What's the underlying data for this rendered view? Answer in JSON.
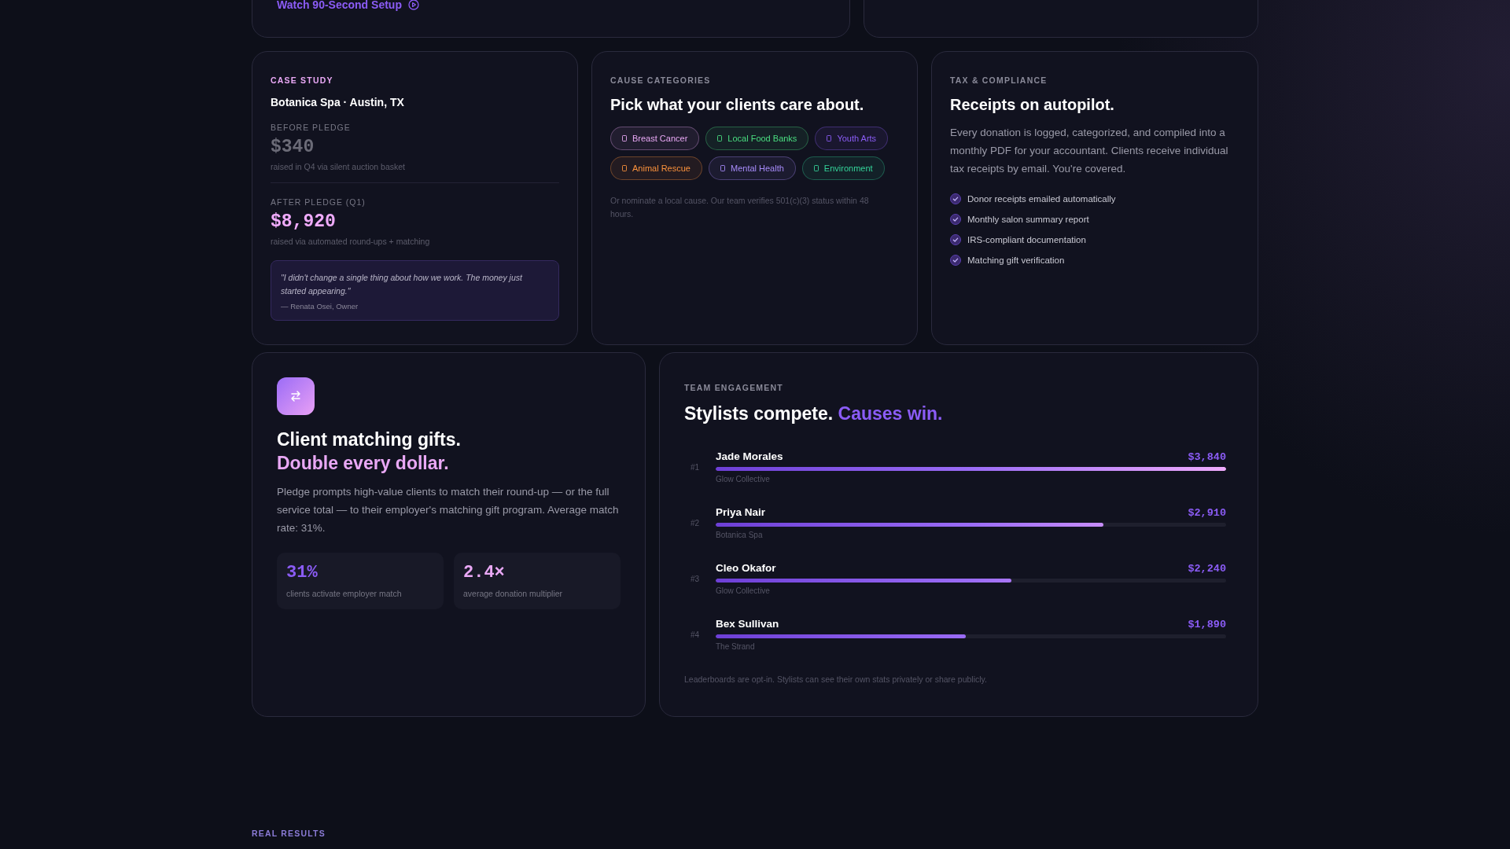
{
  "top_card": {
    "link": "Watch 90-Second Setup"
  },
  "case_study": {
    "eyebrow": "CASE STUDY",
    "title": "Botanica Spa · Austin, TX",
    "before": {
      "label": "BEFORE PLEDGE",
      "amount": "$340",
      "caption": "raised in Q4 via silent auction basket"
    },
    "after": {
      "label": "AFTER PLEDGE (Q1)",
      "amount": "$8,920",
      "caption": "raised via automated round-ups + matching"
    },
    "quote": "\"I didn't change a single thing about how we work. The money just started appearing.\"",
    "attribution": "— Renata Osei, Owner"
  },
  "causes": {
    "eyebrow": "CAUSE CATEGORIES",
    "title": "Pick what your clients care about.",
    "tags": [
      {
        "label": "Breast Cancer",
        "color": "#e9a8f5"
      },
      {
        "label": "Local Food Banks",
        "color": "#4ade80"
      },
      {
        "label": "Youth Arts",
        "color": "#8b5cf6"
      },
      {
        "label": "Animal Rescue",
        "color": "#fb923c"
      },
      {
        "label": "Mental Health",
        "color": "#a78bfa"
      },
      {
        "label": "Environment",
        "color": "#34d399"
      }
    ],
    "note": "Or nominate a local cause. Our team verifies 501(c)(3) status within 48 hours."
  },
  "tax": {
    "eyebrow": "TAX & COMPLIANCE",
    "title": "Receipts on autopilot.",
    "body": "Every donation is logged, categorized, and compiled into a monthly PDF for your accountant. Clients receive individual tax receipts by email. You're covered.",
    "checklist": [
      "Donor receipts emailed automatically",
      "Monthly salon summary report",
      "IRS-compliant documentation",
      "Matching gift verification"
    ]
  },
  "matching": {
    "title": "Client matching gifts.",
    "highlight": "Double every dollar.",
    "body": "Pledge prompts high-value clients to match their round-up — or the full service total — to their employer's matching gift program. Average match rate: 31%.",
    "stats": [
      {
        "value": "31%",
        "label": "clients activate employer match",
        "color": "#8b5cf6"
      },
      {
        "value": "2.4×",
        "label": "average donation multiplier",
        "color": "#e9a8f5"
      }
    ]
  },
  "team": {
    "eyebrow": "TEAM ENGAGEMENT",
    "title": "Stylists compete.",
    "highlight": "Causes win.",
    "leaders": [
      {
        "rank": "#1",
        "name": "Jade Morales",
        "amount": "$3,840",
        "salon": "Glow Collective",
        "level": 1.0
      },
      {
        "rank": "#2",
        "name": "Priya Nair",
        "amount": "$2,910",
        "salon": "Botanica Spa",
        "level": 0.76
      },
      {
        "rank": "#3",
        "name": "Cleo Okafor",
        "amount": "$2,240",
        "salon": "Glow Collective",
        "level": 0.58
      },
      {
        "rank": "#4",
        "name": "Bex Sullivan",
        "amount": "$1,890",
        "salon": "The Strand",
        "level": 0.49
      }
    ],
    "note": "Leaderboards are opt-in. Stylists can see their own stats privately or share publicly."
  },
  "next_section": {
    "eyebrow": "REAL RESULTS"
  }
}
